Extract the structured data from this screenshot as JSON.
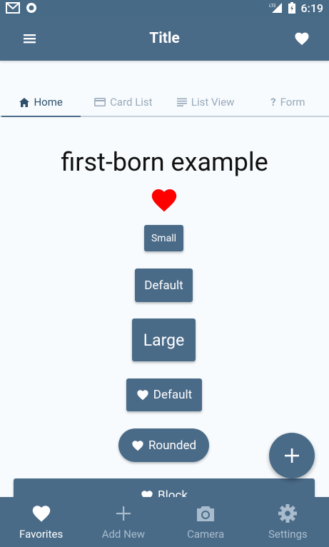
{
  "status_bar": {
    "time": "6:19",
    "left_icons": [
      "gmail-icon",
      "record-icon"
    ],
    "right_icons": [
      "lte-signal-icon",
      "battery-icon"
    ]
  },
  "app_bar": {
    "title": "Title",
    "menu_icon": "hamburger-icon",
    "action_icon": "heart-icon"
  },
  "tabs": [
    {
      "label": "Home",
      "icon": "home-icon",
      "active": true
    },
    {
      "label": "Card List",
      "icon": "credit-card-icon",
      "active": false
    },
    {
      "label": "List View",
      "icon": "list-lines-icon",
      "active": false
    },
    {
      "label": "Form",
      "icon": "question-icon",
      "active": false
    }
  ],
  "main": {
    "heading": "first-born example",
    "heart_color": "#ff0000",
    "buttons": {
      "small": "Small",
      "default": "Default",
      "large": "Large",
      "icon_default": "Default",
      "rounded": "Rounded",
      "block": "Block"
    }
  },
  "fab": {
    "icon": "plus-icon"
  },
  "bottom_nav": [
    {
      "label": "Favorites",
      "icon": "heart-icon",
      "active": true
    },
    {
      "label": "Add New",
      "icon": "plus-icon",
      "active": false
    },
    {
      "label": "Camera",
      "icon": "camera-icon",
      "active": false
    },
    {
      "label": "Settings",
      "icon": "gear-icon",
      "active": false
    }
  ],
  "colors": {
    "primary": "#4a6b88",
    "background": "#f7fbfe",
    "accent_heart": "#ff0000"
  }
}
